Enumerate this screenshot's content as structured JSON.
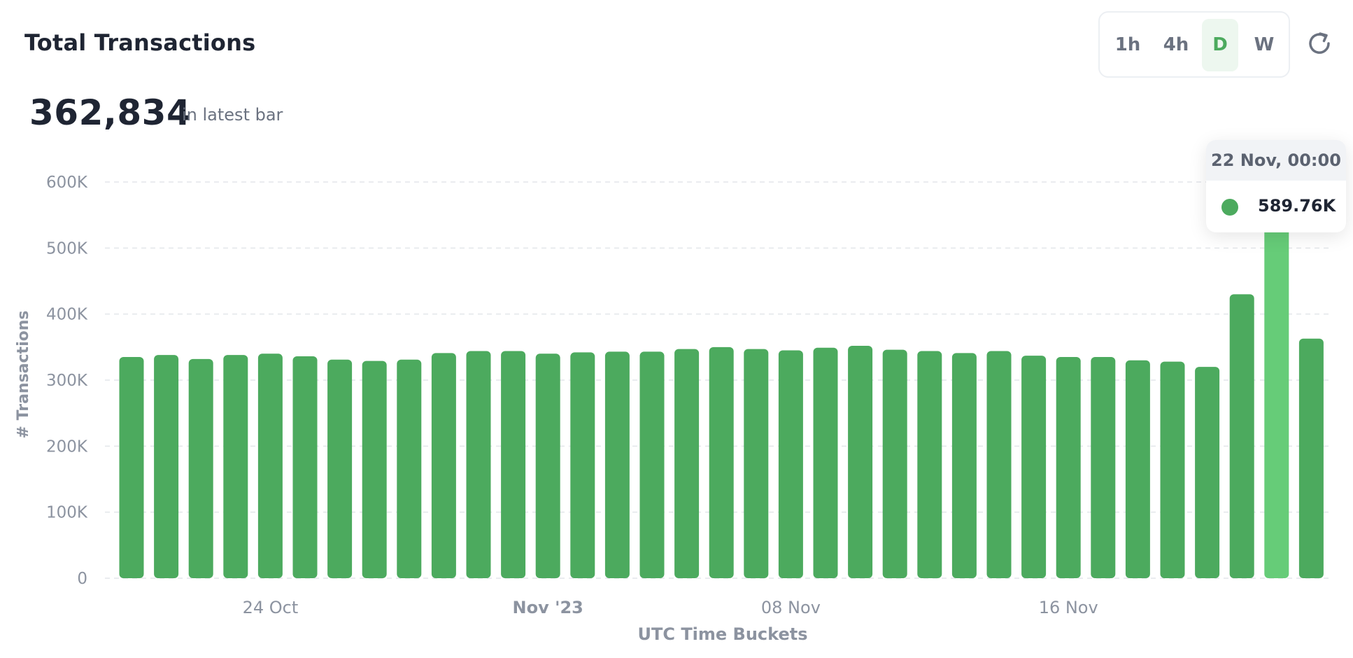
{
  "header": {
    "title": "Total Transactions",
    "big_value": "362,834",
    "big_value_suffix": "in latest bar"
  },
  "interval_tabs": [
    {
      "label": "1h",
      "active": false
    },
    {
      "label": "4h",
      "active": false
    },
    {
      "label": "D",
      "active": true
    },
    {
      "label": "W",
      "active": false
    }
  ],
  "icons": {
    "refresh": "refresh-icon"
  },
  "colors": {
    "bar": "#4caa5e",
    "bar_highlight": "#66cc78",
    "grid": "#e3e6ea",
    "axis_text": "#8c93a0",
    "active_tab_bg": "#edf7ef"
  },
  "tooltip": {
    "date": "22 Nov, 00:00",
    "value": "589.76K"
  },
  "chart_data": {
    "type": "bar",
    "title": "Total Transactions",
    "xlabel": "UTC Time Buckets",
    "ylabel": "# Transactions",
    "ylim": [
      0,
      600000
    ],
    "yticks": [
      0,
      100000,
      200000,
      300000,
      400000,
      500000,
      600000
    ],
    "ytick_labels": [
      "0",
      "100K",
      "200K",
      "300K",
      "400K",
      "500K",
      "600K"
    ],
    "x": [
      "2023-10-20",
      "2023-10-21",
      "2023-10-22",
      "2023-10-23",
      "2023-10-24",
      "2023-10-25",
      "2023-10-26",
      "2023-10-27",
      "2023-10-28",
      "2023-10-29",
      "2023-10-30",
      "2023-10-31",
      "2023-11-01",
      "2023-11-02",
      "2023-11-03",
      "2023-11-04",
      "2023-11-05",
      "2023-11-06",
      "2023-11-07",
      "2023-11-08",
      "2023-11-09",
      "2023-11-10",
      "2023-11-11",
      "2023-11-12",
      "2023-11-13",
      "2023-11-14",
      "2023-11-15",
      "2023-11-16",
      "2023-11-17",
      "2023-11-18",
      "2023-11-19",
      "2023-11-20",
      "2023-11-21",
      "2023-11-22",
      "2023-11-23"
    ],
    "xtick_labels": [
      {
        "x": "2023-10-24",
        "label": "24 Oct",
        "bold": false
      },
      {
        "x": "2023-11-01",
        "label": "Nov '23",
        "bold": true
      },
      {
        "x": "2023-11-08",
        "label": "08 Nov",
        "bold": false
      },
      {
        "x": "2023-11-16",
        "label": "16 Nov",
        "bold": false
      }
    ],
    "values": [
      335000,
      338000,
      332000,
      338000,
      340000,
      336000,
      331000,
      329000,
      331000,
      341000,
      344000,
      344000,
      340000,
      342000,
      343000,
      343000,
      347000,
      350000,
      347000,
      345000,
      349000,
      352000,
      346000,
      344000,
      341000,
      344000,
      337000,
      335000,
      335000,
      330000,
      328000,
      320000,
      430000,
      589760,
      362834
    ],
    "highlight_index": 33,
    "grid": true,
    "legend": "none"
  }
}
